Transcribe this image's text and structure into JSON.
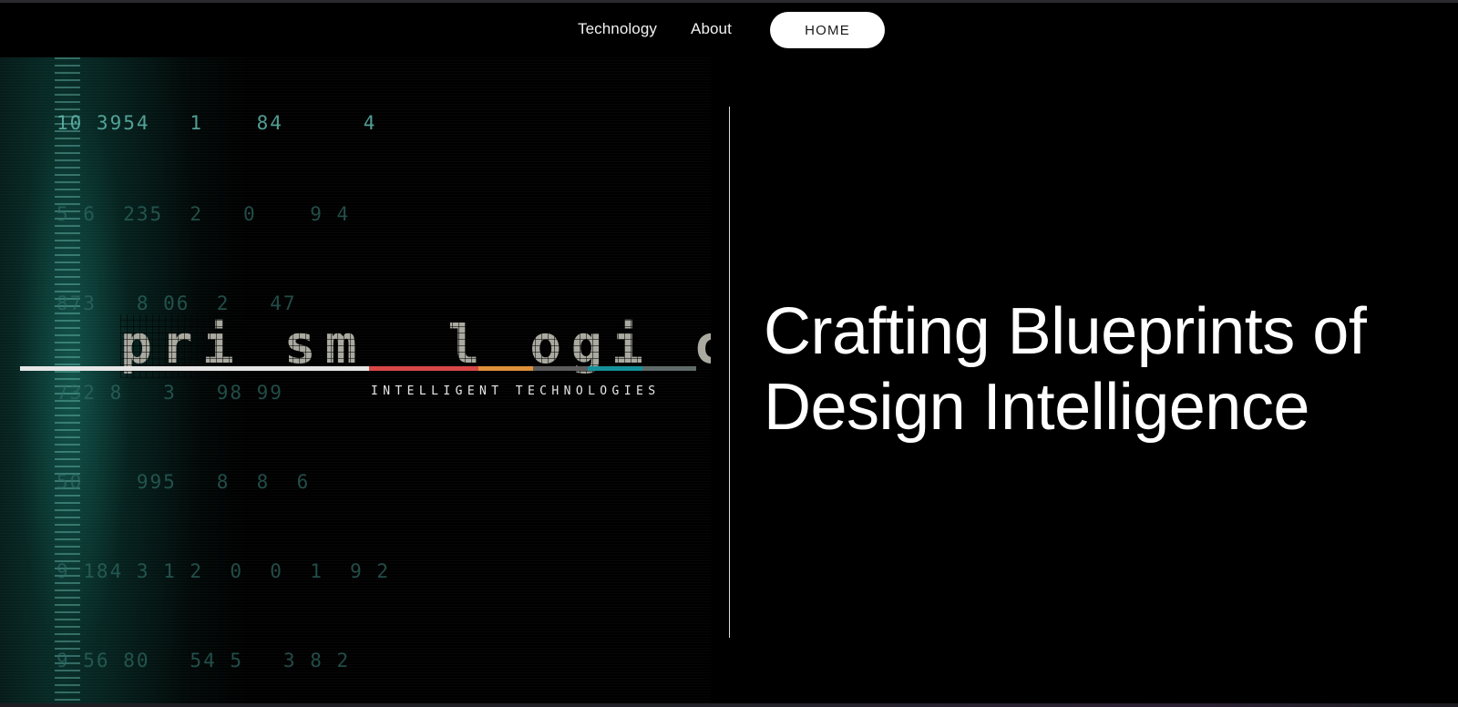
{
  "nav": {
    "technology_label": "Technology",
    "about_label": "About",
    "home_label": "HOME"
  },
  "hero_image": {
    "logo_word": "pri sm  l ogi c",
    "logo_tagline": "INTELLIGENT TECHNOLOGIES",
    "digit_rows": [
      "10 3954   1    84      4",
      "5 6  235  2   0    9 4",
      "873   8 06  2   47",
      "732 8   3   98 99",
      "50    995   8  8  6",
      "9 184 3 1 2  0  0  1  9 2",
      "9 56 80   54 5   3 8 2"
    ],
    "bar_colors": [
      "#e6e6e6",
      "#d84646",
      "#e0903a",
      "#5c5c5c",
      "#14909a",
      "#5e6a68"
    ]
  },
  "headline": {
    "line1": "Crafting Blueprints of",
    "line2": "Design Intelligence"
  },
  "colors": {
    "background": "#000000",
    "accent_teal": "#5fb8ad",
    "home_button_bg": "#ffffff"
  }
}
